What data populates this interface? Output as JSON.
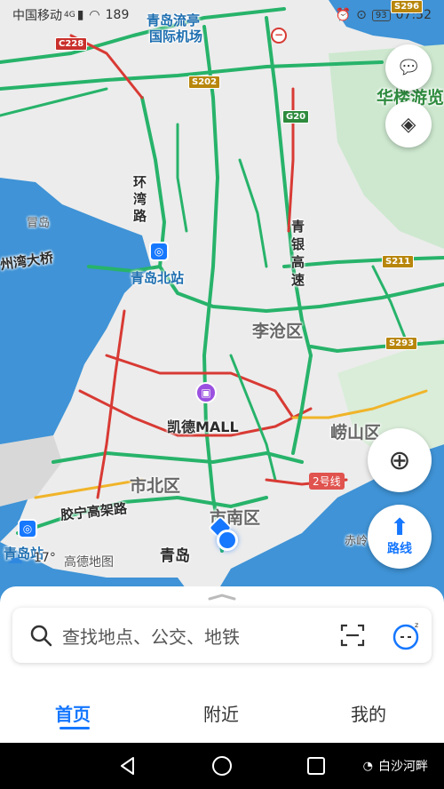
{
  "status_bar": {
    "carrier": "中国移动",
    "network": "4G",
    "time_partial": "189",
    "battery": "93",
    "clock": "07:52"
  },
  "map": {
    "districts": {
      "licang": "李沧区",
      "shinan": "市南区",
      "shibei": "市北区",
      "laoshan": "崂山区"
    },
    "places": {
      "airport_line1": "青岛流亭",
      "airport_line2": "国际机场",
      "qingdao_north": "青岛北站",
      "qingdao_station": "青岛站",
      "qingdao": "青岛",
      "kaide_mall": "凯德MALL",
      "huanlou": "华楼游览",
      "guandao": "冒岛",
      "chiling": "赤岭"
    },
    "roads": {
      "huanwan": "环湾路",
      "qingyin": "青银高速",
      "jiaozhou_bridge": "州湾大桥",
      "jiaoning": "胶宁高架路",
      "line2": "2号线"
    },
    "shields": {
      "c228": "C228",
      "s202": "S202",
      "g20": "G20",
      "s211": "S211",
      "s293": "S293",
      "s296": "S296"
    },
    "weather": {
      "temp": "17°"
    },
    "brand": "高德地图"
  },
  "controls": {
    "route_label": "路线"
  },
  "search": {
    "placeholder": "查找地点、公交、地铁"
  },
  "tabs": {
    "home": "首页",
    "nearby": "附近",
    "mine": "我的"
  },
  "watermark": "白沙河畔",
  "colors": {
    "accent": "#1677ff",
    "traffic_green": "#27b36a",
    "traffic_red": "#d83a34",
    "traffic_yellow": "#f0b429",
    "water": "#3f93d6",
    "land": "#ececec",
    "park": "#cde8cf"
  }
}
